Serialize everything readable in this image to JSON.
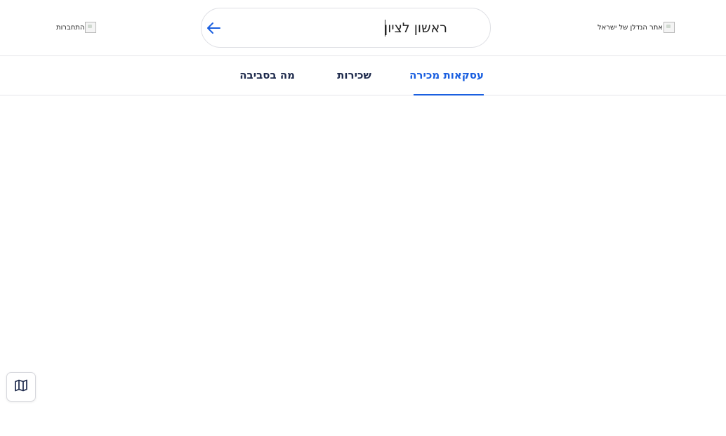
{
  "header": {
    "logo_alt": "אתר הנדלן של ישראל",
    "login_alt": "התחברות",
    "search": {
      "value": "ראשון לציון",
      "placeholder": ""
    },
    "back_icon": "arrow-left-icon"
  },
  "tabs": [
    {
      "label": "עסקאות מכירה",
      "active": true
    },
    {
      "label": "שכירות",
      "active": false
    },
    {
      "label": "מה בסביבה",
      "active": false
    }
  ],
  "map_button": {
    "icon": "map-icon"
  },
  "colors": {
    "accent": "#1a5fe0",
    "tab_text": "#1f2b4d",
    "border": "#e5e5ea"
  }
}
